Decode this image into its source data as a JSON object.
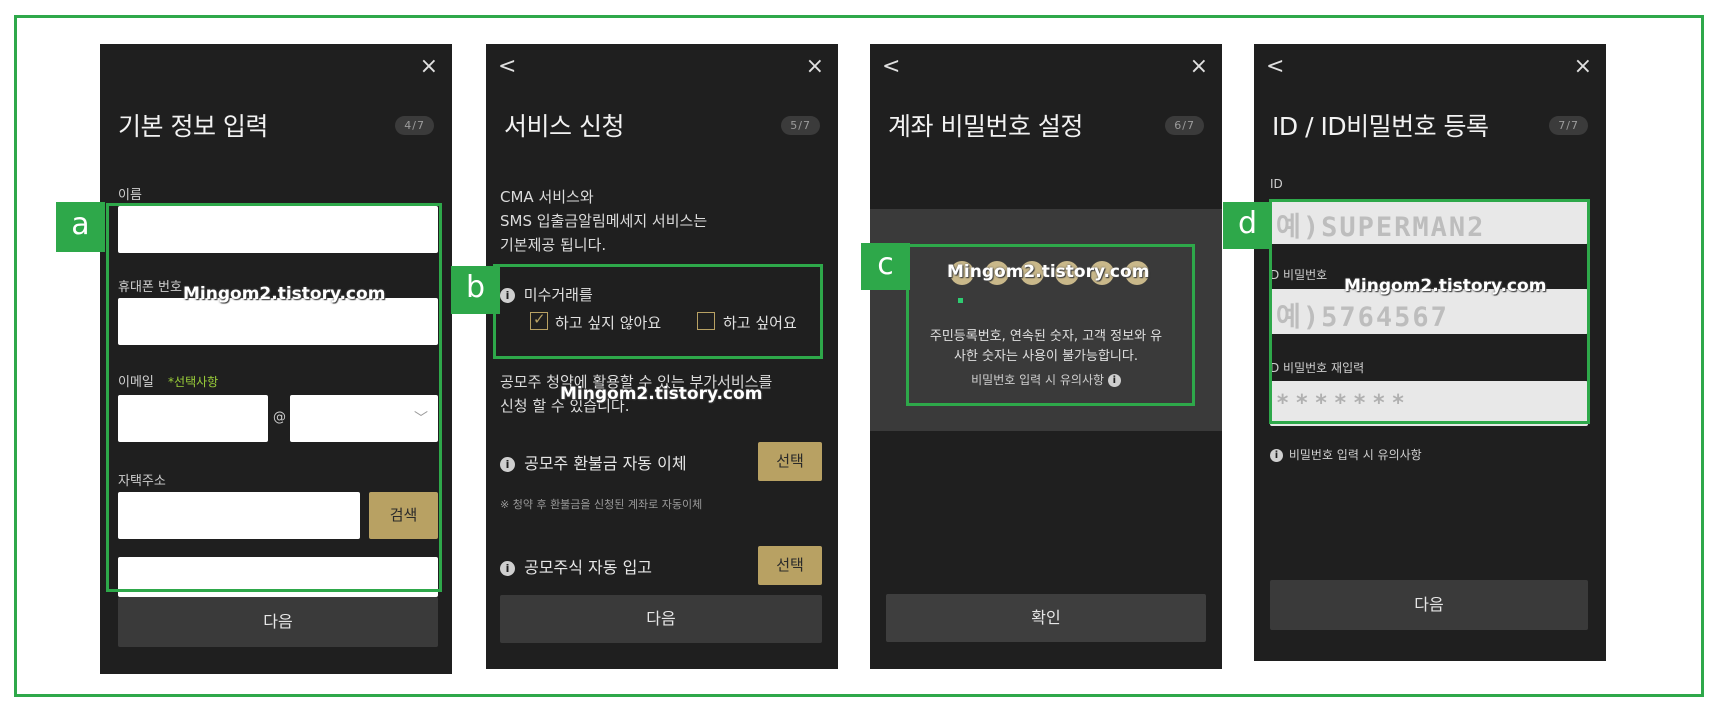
{
  "tags": {
    "a": "a",
    "b": "b",
    "c": "c",
    "d": "d"
  },
  "watermark": "Mingom2.tistory.com",
  "panel1": {
    "close_icon": "×",
    "title": "기본 정보 입력",
    "step": "4/7",
    "name_label": "이름",
    "phone_label": "휴대폰 번호",
    "email_label": "이메일",
    "email_optional": "*선택사항",
    "at_sign": "@",
    "chevron": "﹀",
    "address_label": "자택주소",
    "search_button": "검색",
    "next_button": "다음"
  },
  "panel2": {
    "back_icon": "<",
    "close_icon": "×",
    "title": "서비스 신청",
    "step": "5/7",
    "desc_line1": "CMA 서비스와",
    "desc_line2": "SMS 입출금알림메세지 서비스는",
    "desc_line3": "기본제공 됩니다.",
    "unsettled_label": "미수거래를",
    "option_no": "하고 싶지 않아요",
    "option_yes": "하고 싶어요",
    "ipo_line1": "공모주 청약에 활용할 수 있는 부가서비스를",
    "ipo_line2": "신청 할 수 있습니다.",
    "refund_label": "공모주 환불금 자동 이체",
    "select_button": "선택",
    "refund_note": "※ 청약 후 환불금을 신청된 계좌로 자동이체",
    "stock_label": "공모주식 자동 입고",
    "next_button": "다음"
  },
  "panel3": {
    "back_icon": "<",
    "close_icon": "×",
    "title": "계좌 비밀번호 설정",
    "step": "6/7",
    "warning_line1": "주민등록번호, 연속된 숫자, 고객 정보와 유",
    "warning_line2": "사한 숫자는 사용이 불가능합니다.",
    "notice_link": "비밀번호 입력 시 유의사항",
    "confirm_button": "확인"
  },
  "panel4": {
    "back_icon": "<",
    "close_icon": "×",
    "title": "ID / ID비밀번호 등록",
    "step": "7/7",
    "id_label": "ID",
    "id_placeholder": "예)SUPERMAN2",
    "pw_label": "D 비밀번호",
    "pw_placeholder": "예)5764567",
    "pw_confirm_label": "D 비밀번호 재입력",
    "pw_confirm_value": "*******",
    "notice_link": "비밀번호 입력 시 유의사항",
    "next_button": "다음"
  }
}
